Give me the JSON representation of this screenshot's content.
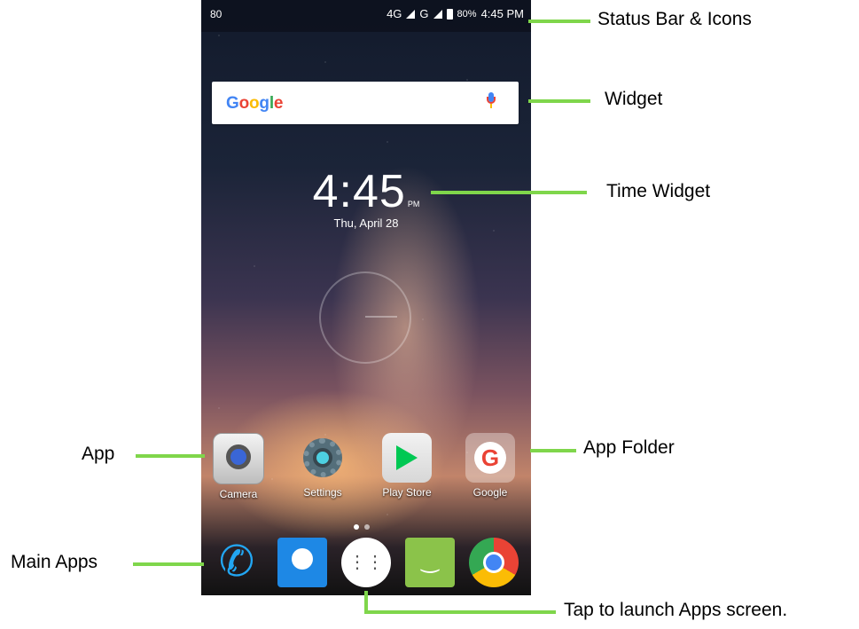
{
  "status_bar": {
    "left_indicator": "80",
    "network": "4G",
    "network2": "G",
    "battery_percent": "80%",
    "time": "4:45 PM"
  },
  "search_widget": {
    "logo": "Google",
    "mic_icon": "microphone-icon"
  },
  "clock_widget": {
    "time": "4:45",
    "ampm": "PM",
    "date": "Thu, April 28"
  },
  "home_apps": [
    {
      "label": "Camera",
      "icon": "camera-icon"
    },
    {
      "label": "Settings",
      "icon": "gear-icon"
    },
    {
      "label": "Play Store",
      "icon": "play-store-icon"
    },
    {
      "label": "Google",
      "icon": "google-folder-icon"
    }
  ],
  "page_indicator": {
    "pages": 2,
    "current": 1
  },
  "dock": [
    {
      "icon": "phone-icon"
    },
    {
      "icon": "contacts-icon"
    },
    {
      "icon": "app-launcher-icon"
    },
    {
      "icon": "messaging-icon"
    },
    {
      "icon": "chrome-icon"
    }
  ],
  "annotations": {
    "status": "Status Bar & Icons",
    "widget": "Widget",
    "time_widget": "Time Widget",
    "app": "App",
    "app_folder": "App Folder",
    "main_apps": "Main Apps",
    "launcher": "Tap to launch Apps screen."
  },
  "accent_colors": {
    "callout_line": "#7fd64b",
    "google_blue": "#4285f4",
    "google_red": "#ea4335",
    "google_yellow": "#fbbc05",
    "google_green": "#34a853"
  }
}
